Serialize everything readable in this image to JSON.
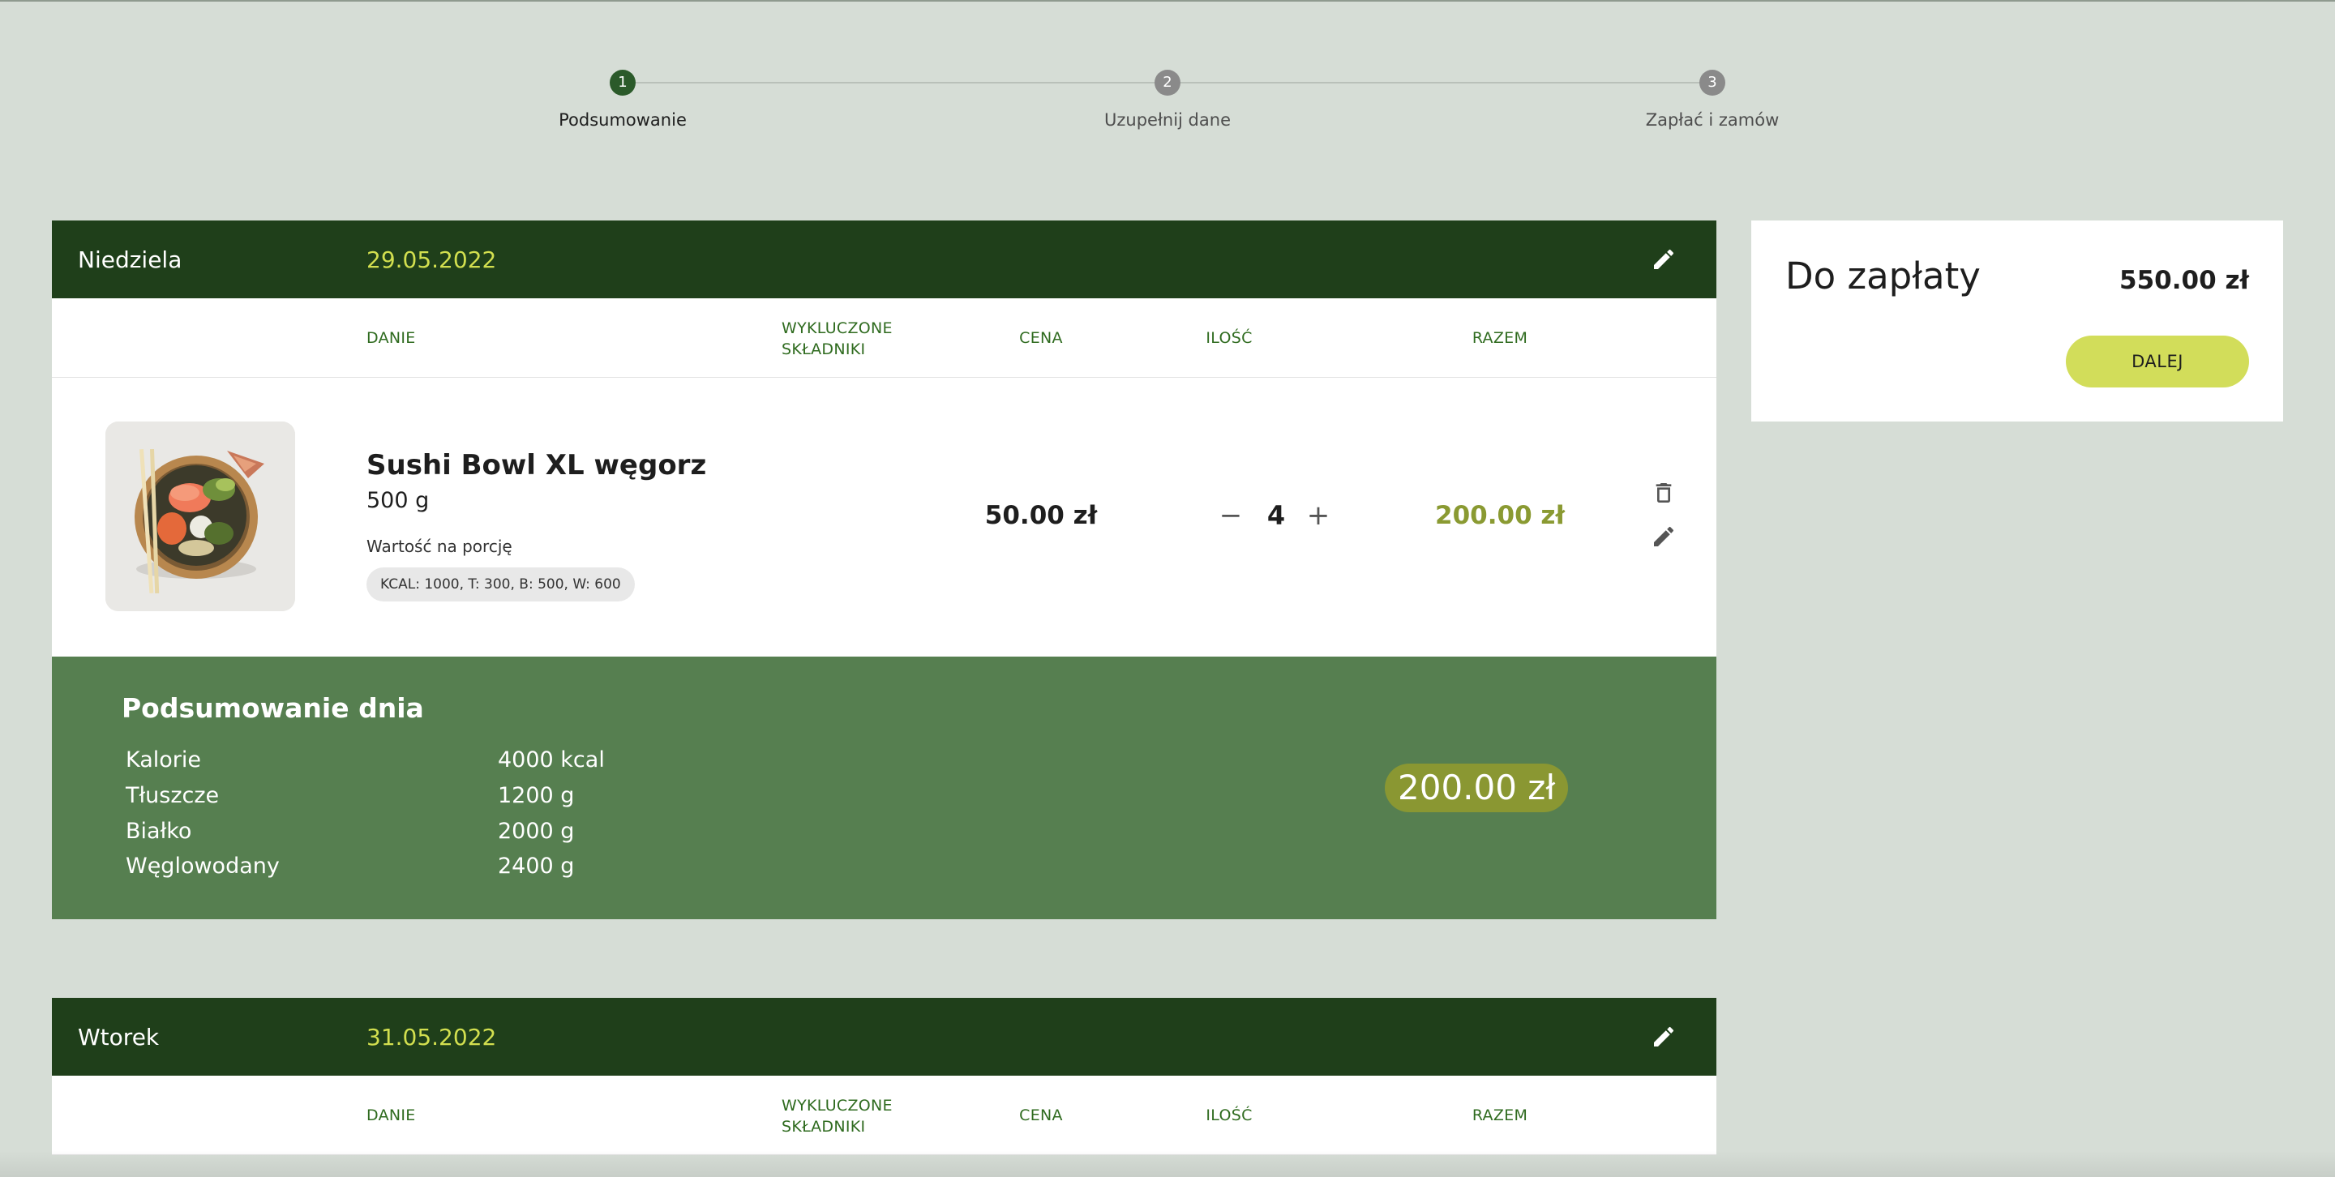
{
  "stepper": {
    "steps": [
      {
        "number": "1",
        "label": "Podsumowanie",
        "active": true
      },
      {
        "number": "2",
        "label": "Uzupełnij dane",
        "active": false
      },
      {
        "number": "3",
        "label": "Zapłać i zamów",
        "active": false
      }
    ]
  },
  "columns": {
    "dishes": "DANIE",
    "excluded_line1": "WYKLUCZONE",
    "excluded_line2": "SKŁADNIKI",
    "price": "CENA",
    "quantity": "ILOŚĆ",
    "total": "RAZEM"
  },
  "days": [
    {
      "name": "Niedziela",
      "date": "29.05.2022",
      "items": [
        {
          "name": "Sushi Bowl XL węgorz",
          "weight": "500 g",
          "nutrition_label": "Wartość na porcję",
          "nutrition": "KCAL: 1000, T: 300, B: 500, W: 600",
          "price": "50.00 zł",
          "quantity": "4",
          "total": "200.00 zł"
        }
      ],
      "summary": {
        "title": "Podsumowanie dnia",
        "rows": [
          {
            "label": "Kalorie",
            "value": "4000 kcal"
          },
          {
            "label": "Tłuszcze",
            "value": "1200 g"
          },
          {
            "label": "Białko",
            "value": "2000 g"
          },
          {
            "label": "Węglowodany",
            "value": "2400 g"
          }
        ],
        "total": "200.00 zł"
      }
    },
    {
      "name": "Wtorek",
      "date": "31.05.2022"
    }
  ],
  "payment": {
    "title": "Do zapłaty",
    "amount": "550.00 zł",
    "button": "DALEJ"
  },
  "colors": {
    "background": "#d6ddd6",
    "header_green": "#1f3f1a",
    "summary_green": "#567f50",
    "accent_lime": "#d2dd5a",
    "date_yellow": "#d2df4f",
    "total_olive": "#8a9a32"
  },
  "icons": {
    "edit": "pencil-icon",
    "delete": "trash-icon",
    "minus": "minus-icon",
    "plus": "plus-icon"
  }
}
